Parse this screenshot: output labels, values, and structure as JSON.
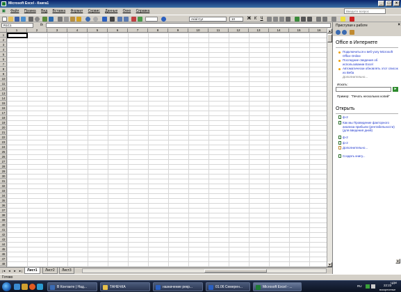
{
  "window": {
    "title": "Microsoft Excel - Книга1",
    "colors": {
      "accent": "#0a246a",
      "chrome": "#d4d0c8",
      "excel_green": "#1e7b34"
    }
  },
  "menu": {
    "items": [
      "Файл",
      "Правка",
      "Вид",
      "Вставка",
      "Формат",
      "Сервис",
      "Данные",
      "Окно",
      "Справка"
    ],
    "help_placeholder": "Введите вопрос"
  },
  "toolbar": {
    "font": "Arial Cyr",
    "size": "10"
  },
  "formula_bar": {
    "name_box": "R1C1",
    "fx": "fx",
    "value": ""
  },
  "grid": {
    "columns": [
      "1",
      "2",
      "3",
      "4",
      "5",
      "6",
      "7",
      "8",
      "9",
      "10",
      "11",
      "12",
      "13",
      "14",
      "15",
      "16"
    ],
    "rows": [
      "1",
      "2",
      "3",
      "4",
      "5",
      "6",
      "7",
      "8",
      "9",
      "10",
      "11",
      "12",
      "13",
      "14",
      "15",
      "16",
      "17",
      "18",
      "19",
      "20",
      "21",
      "22",
      "23",
      "24",
      "25",
      "26",
      "27",
      "28",
      "29",
      "30",
      "31",
      "32",
      "33",
      "34",
      "35",
      "36",
      "37",
      "38",
      "39",
      "40",
      "41",
      "42",
      "43",
      "44",
      "45",
      "46",
      "47",
      "48",
      "49"
    ]
  },
  "sheets": {
    "nav": [
      "|◄",
      "◄",
      "►",
      "►|"
    ],
    "tabs": [
      "Лист1",
      "Лист2",
      "Лист3"
    ],
    "active": "Лист1"
  },
  "status": {
    "text": "Готово"
  },
  "task_pane": {
    "title": "Приступая к работе",
    "close": "×",
    "section_online": "Office в Интернете",
    "online_links": [
      "Подключиться к веб-узлу Microsoft Office Online",
      "Последние сведения об использовании Excel",
      "Автоматически обновлять этот список из Веба"
    ],
    "more_online": "Дополнительно...",
    "search_label": "Искать:",
    "search_value": "",
    "search_go": "►",
    "example_label": "Пример:",
    "example_text": "\"Печать нескольких копий\"",
    "section_open": "Открыть",
    "open_files": [
      "ф-2",
      "Как мы Проведение факторного анализа прибыли (рентабельности) (для введения дней)",
      "ф-2",
      "ф-2"
    ],
    "more_open": "Дополнительно...",
    "create": "Создать книгу..."
  },
  "taskbar": {
    "tasks": [
      {
        "label": "В Контакте | Над...",
        "icon_color": "#3b6bb3"
      },
      {
        "label": "ТАНЕЧКА",
        "icon_color": "#e8c04a"
      },
      {
        "label": "назначение рекр...",
        "icon_color": "#2a5fbf"
      },
      {
        "label": "01.06 Семерен...",
        "icon_color": "#2a5fbf"
      },
      {
        "label": "Microsoft Excel - ...",
        "icon_color": "#1e7b34"
      }
    ],
    "active_index": 4,
    "lang": "RU",
    "time": "22:23",
    "day": "воскресенье",
    "tray_label": "ЦДМ"
  }
}
